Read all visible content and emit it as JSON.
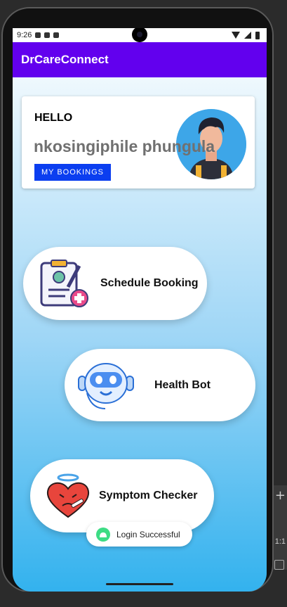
{
  "status_bar": {
    "time": "9:26"
  },
  "app_bar": {
    "title": "DrCareConnect"
  },
  "greeting_card": {
    "hello": "HELLO",
    "user_name": "nkosingiphile phungula",
    "bookings_button": "MY BOOKINGS"
  },
  "menu": [
    {
      "label": "Schedule Booking",
      "icon": "clipboard-medical-icon"
    },
    {
      "label": "Health Bot",
      "icon": "robot-icon"
    },
    {
      "label": "Symptom Checker",
      "icon": "sick-heart-icon"
    }
  ],
  "toast": {
    "message": "Login Successful",
    "icon": "android-icon"
  },
  "colors": {
    "app_bar": "#6200ee",
    "button": "#0b3ef0",
    "gradient_bottom": "#33b2ee"
  }
}
